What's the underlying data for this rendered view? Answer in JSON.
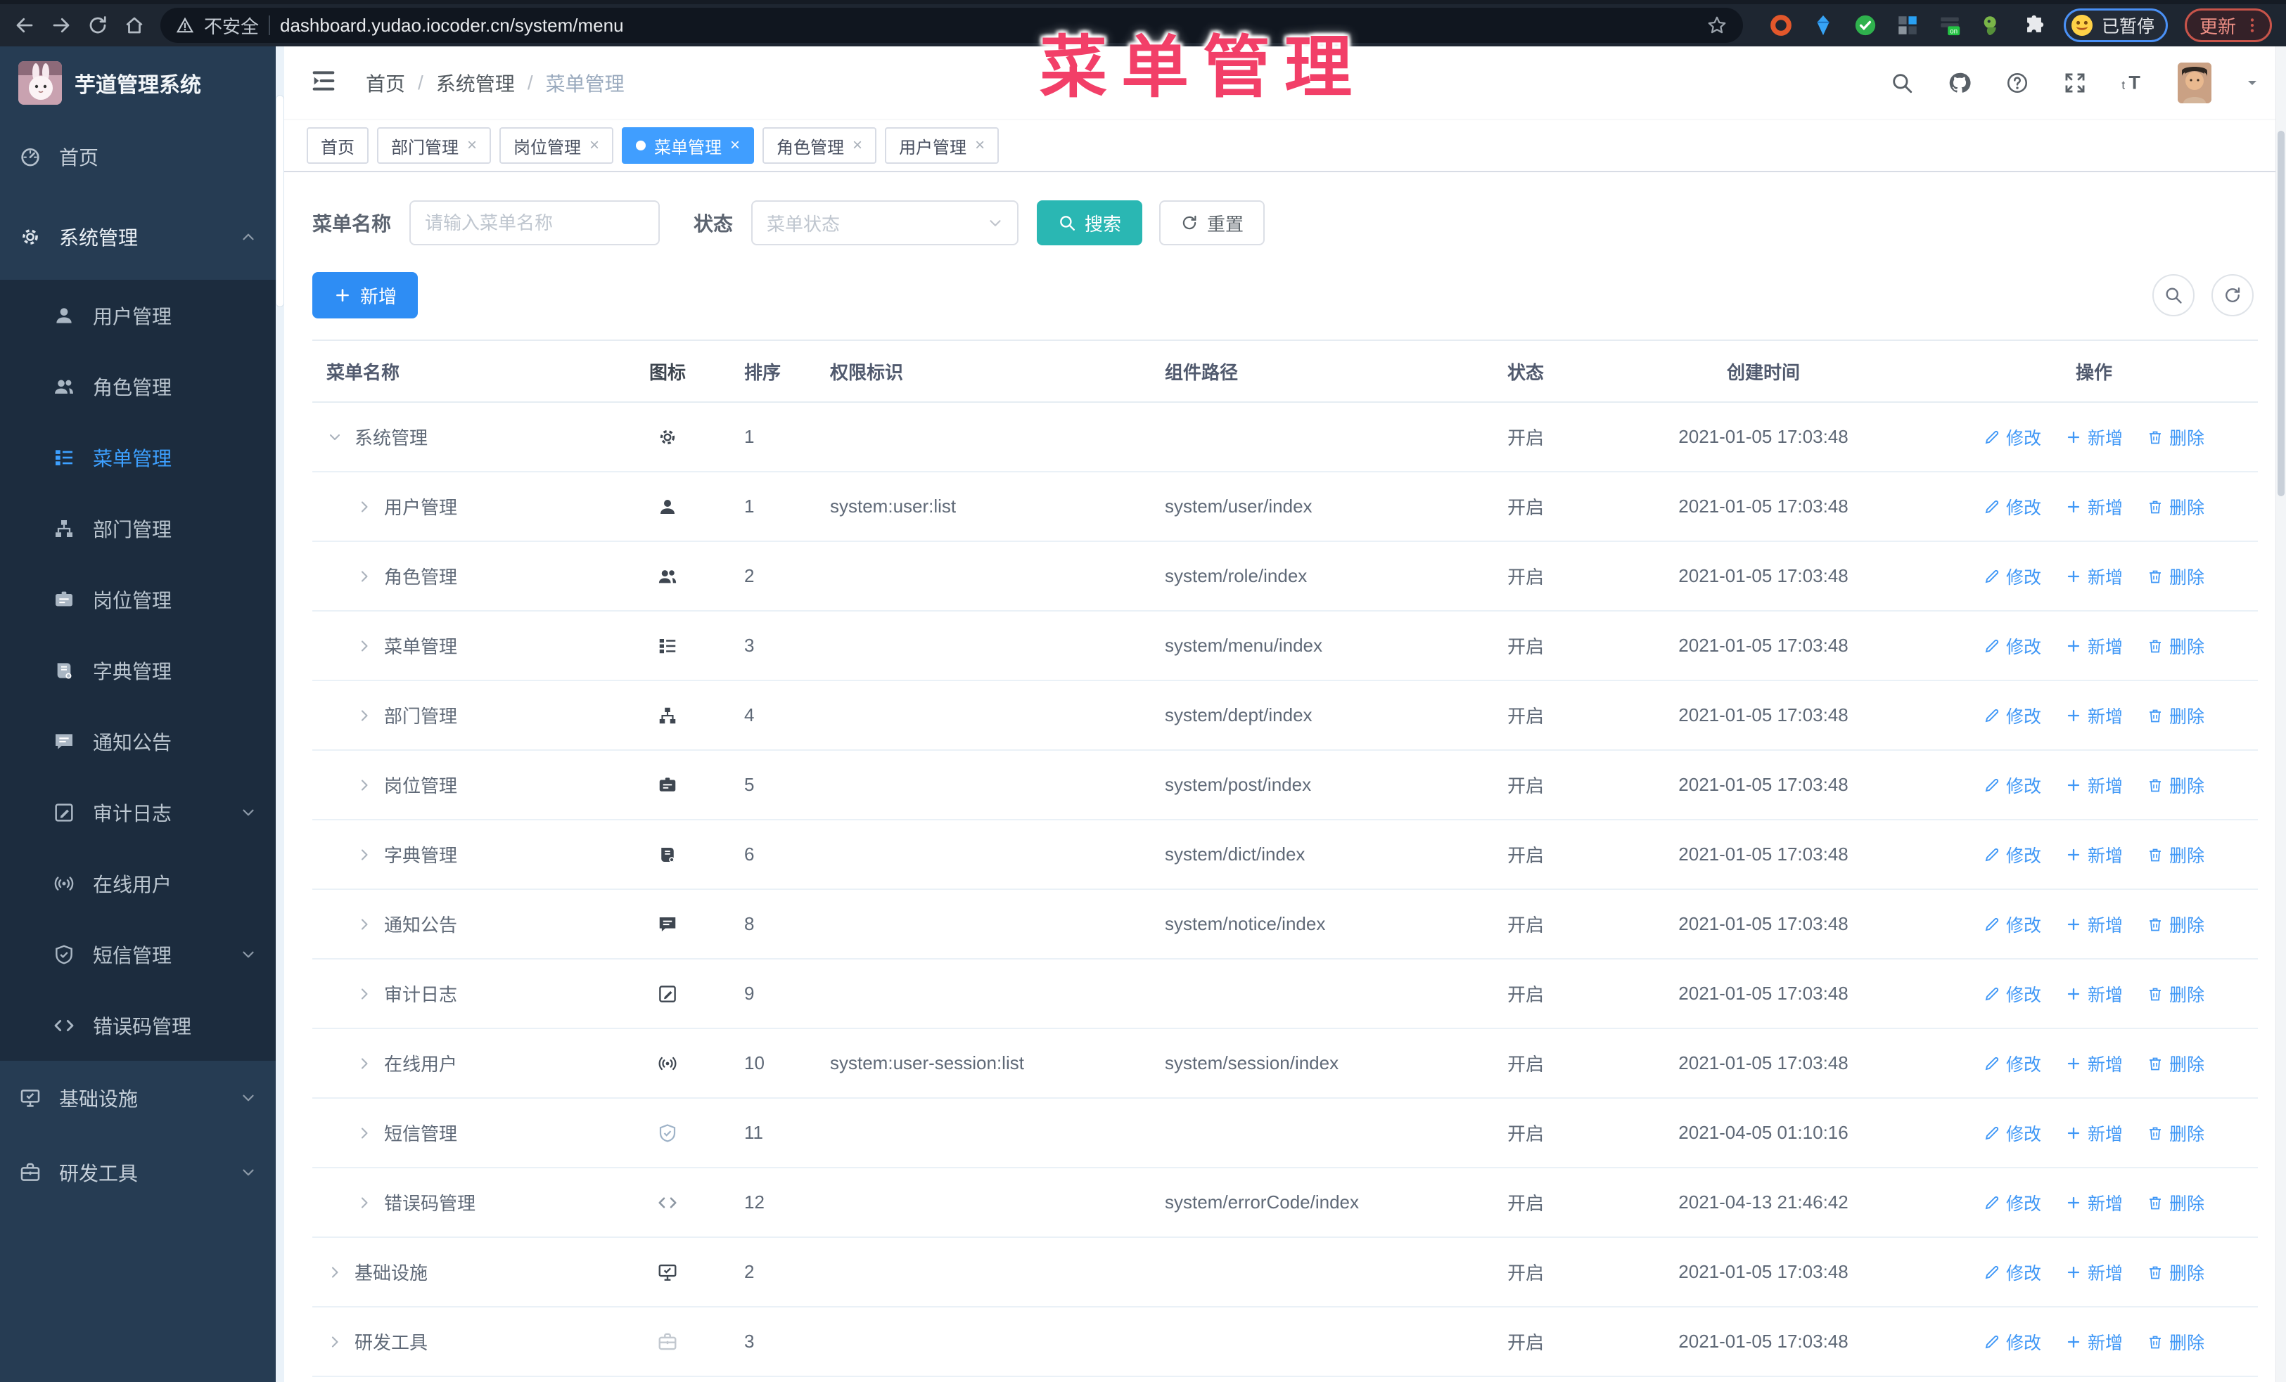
{
  "browser": {
    "security_label": "不安全",
    "url": "dashboard.yudao.iocoder.cn/system/menu",
    "extension_badge": "on",
    "profile_status": "已暂停",
    "update_label": "更新"
  },
  "overlay_title": "菜单管理",
  "glyphs": {
    "close": "×",
    "crumb_sep": "/"
  },
  "colors": {
    "accent": "#409eff",
    "search_teal": "#2ab7b3",
    "add_blue": "#2e8df4",
    "link_blue": "#3f97f6",
    "title_pink": "#f23f68",
    "sidebar_bg": "#263c53",
    "submenu_bg": "#1c2c3e"
  },
  "sidebar": {
    "logo_title": "芋道管理系统",
    "items": [
      {
        "key": "home",
        "label": "首页",
        "icon": "dashboard",
        "type": "top"
      },
      {
        "key": "system",
        "label": "系统管理",
        "icon": "gear",
        "type": "top",
        "parent_open": true,
        "chevron": "up"
      },
      {
        "key": "user",
        "label": "用户管理",
        "icon": "user",
        "type": "sub"
      },
      {
        "key": "role",
        "label": "角色管理",
        "icon": "users",
        "type": "sub"
      },
      {
        "key": "menu",
        "label": "菜单管理",
        "icon": "menu",
        "type": "sub",
        "active": true
      },
      {
        "key": "dept",
        "label": "部门管理",
        "icon": "tree",
        "type": "sub"
      },
      {
        "key": "post",
        "label": "岗位管理",
        "icon": "idcard",
        "type": "sub"
      },
      {
        "key": "dict",
        "label": "字典管理",
        "icon": "book",
        "type": "sub"
      },
      {
        "key": "notice",
        "label": "通知公告",
        "icon": "message",
        "type": "sub"
      },
      {
        "key": "audit",
        "label": "审计日志",
        "icon": "edit",
        "type": "sub",
        "chevron": "down"
      },
      {
        "key": "online",
        "label": "在线用户",
        "icon": "online",
        "type": "sub"
      },
      {
        "key": "sms",
        "label": "短信管理",
        "icon": "shield",
        "type": "sub",
        "chevron": "down"
      },
      {
        "key": "errcode",
        "label": "错误码管理",
        "icon": "code",
        "type": "sub"
      },
      {
        "key": "infra",
        "label": "基础设施",
        "icon": "monitor",
        "type": "top",
        "chevron": "down"
      },
      {
        "key": "devtool",
        "label": "研发工具",
        "icon": "tool",
        "type": "top",
        "chevron": "down"
      }
    ]
  },
  "navbar": {
    "breadcrumb": [
      "首页",
      "系统管理",
      "菜单管理"
    ]
  },
  "tabs": [
    {
      "key": "home",
      "label": "首页",
      "closable": false,
      "active": false
    },
    {
      "key": "dept",
      "label": "部门管理",
      "closable": true,
      "active": false
    },
    {
      "key": "post",
      "label": "岗位管理",
      "closable": true,
      "active": false
    },
    {
      "key": "menu",
      "label": "菜单管理",
      "closable": true,
      "active": true
    },
    {
      "key": "role",
      "label": "角色管理",
      "closable": true,
      "active": false
    },
    {
      "key": "user",
      "label": "用户管理",
      "closable": true,
      "active": false
    }
  ],
  "search": {
    "name_label": "菜单名称",
    "name_placeholder": "请输入菜单名称",
    "status_label": "状态",
    "status_placeholder": "菜单状态",
    "search_button": "搜索",
    "reset_button": "重置"
  },
  "toolbar": {
    "add_button": "新增"
  },
  "table": {
    "columns": [
      "菜单名称",
      "图标",
      "排序",
      "权限标识",
      "组件路径",
      "状态",
      "创建时间",
      "操作"
    ],
    "op_labels": {
      "edit": "修改",
      "add": "新增",
      "delete": "删除"
    },
    "rows": [
      {
        "key": "system",
        "name": "系统管理",
        "level": 0,
        "expanded": true,
        "icon": "gear",
        "sort": "1",
        "perm": "",
        "path": "",
        "status": "开启",
        "time": "2021-01-05 17:03:48"
      },
      {
        "key": "user",
        "name": "用户管理",
        "level": 1,
        "icon": "user",
        "sort": "1",
        "perm": "system:user:list",
        "path": "system/user/index",
        "status": "开启",
        "time": "2021-01-05 17:03:48"
      },
      {
        "key": "role",
        "name": "角色管理",
        "level": 1,
        "icon": "users",
        "sort": "2",
        "perm": "",
        "path": "system/role/index",
        "status": "开启",
        "time": "2021-01-05 17:03:48"
      },
      {
        "key": "menu",
        "name": "菜单管理",
        "level": 1,
        "icon": "menu",
        "sort": "3",
        "perm": "",
        "path": "system/menu/index",
        "status": "开启",
        "time": "2021-01-05 17:03:48"
      },
      {
        "key": "dept",
        "name": "部门管理",
        "level": 1,
        "icon": "tree",
        "sort": "4",
        "perm": "",
        "path": "system/dept/index",
        "status": "开启",
        "time": "2021-01-05 17:03:48"
      },
      {
        "key": "post",
        "name": "岗位管理",
        "level": 1,
        "icon": "idcard",
        "sort": "5",
        "perm": "",
        "path": "system/post/index",
        "status": "开启",
        "time": "2021-01-05 17:03:48"
      },
      {
        "key": "dict",
        "name": "字典管理",
        "level": 1,
        "icon": "book",
        "sort": "6",
        "perm": "",
        "path": "system/dict/index",
        "status": "开启",
        "time": "2021-01-05 17:03:48"
      },
      {
        "key": "notice",
        "name": "通知公告",
        "level": 1,
        "icon": "message",
        "sort": "8",
        "perm": "",
        "path": "system/notice/index",
        "status": "开启",
        "time": "2021-01-05 17:03:48"
      },
      {
        "key": "audit",
        "name": "审计日志",
        "level": 1,
        "icon": "edit",
        "sort": "9",
        "perm": "",
        "path": "",
        "status": "开启",
        "time": "2021-01-05 17:03:48"
      },
      {
        "key": "online",
        "name": "在线用户",
        "level": 1,
        "icon": "online",
        "sort": "10",
        "perm": "system:user-session:list",
        "path": "system/session/index",
        "status": "开启",
        "time": "2021-01-05 17:03:48"
      },
      {
        "key": "sms",
        "name": "短信管理",
        "level": 1,
        "icon": "shield",
        "icon_color": "#9fb3c8",
        "sort": "11",
        "perm": "",
        "path": "",
        "status": "开启",
        "time": "2021-04-05 01:10:16"
      },
      {
        "key": "errcode",
        "name": "错误码管理",
        "level": 1,
        "icon": "code",
        "icon_color": "#8d97a3",
        "sort": "12",
        "perm": "",
        "path": "system/errorCode/index",
        "status": "开启",
        "time": "2021-04-13 21:46:42"
      },
      {
        "key": "infra",
        "name": "基础设施",
        "level": 0,
        "icon": "monitor",
        "sort": "2",
        "perm": "",
        "path": "",
        "status": "开启",
        "time": "2021-01-05 17:03:48"
      },
      {
        "key": "devtool",
        "name": "研发工具",
        "level": 0,
        "icon": "tool",
        "icon_color": "#c2c8cf",
        "sort": "3",
        "perm": "",
        "path": "",
        "status": "开启",
        "time": "2021-01-05 17:03:48"
      }
    ]
  }
}
